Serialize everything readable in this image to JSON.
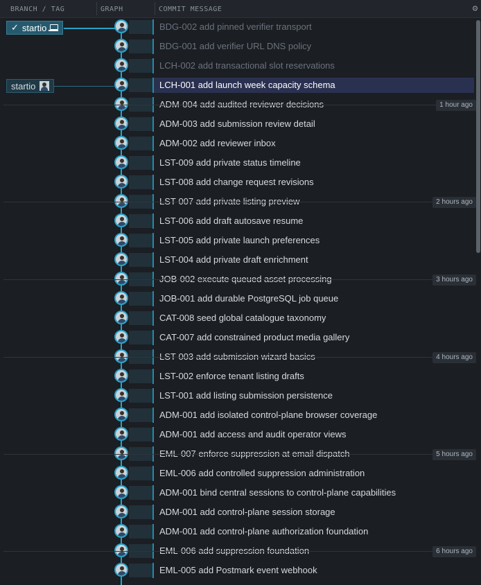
{
  "header": {
    "branch_col": "BRANCH / TAG",
    "graph_col": "GRAPH",
    "message_col": "COMMIT MESSAGE"
  },
  "branches": {
    "local": {
      "label": "startio",
      "check": "✓",
      "icon": "laptop-icon"
    },
    "remote": {
      "label": "startio",
      "icon": "avatar-icon"
    }
  },
  "commits": [
    {
      "message": "BDG-002 add pinned verifier transport",
      "dim": true
    },
    {
      "message": "BDG-001 add verifier URL DNS policy",
      "dim": true
    },
    {
      "message": "LCH-002 add transactional slot reservations",
      "dim": true
    },
    {
      "message": "LCH-001 add launch week capacity schema",
      "selected": true
    },
    {
      "message": "ADM-004 add audited reviewer decisions"
    },
    {
      "message": "ADM-003 add submission review detail"
    },
    {
      "message": "ADM-002 add reviewer inbox"
    },
    {
      "message": "LST-009 add private status timeline"
    },
    {
      "message": "LST-008 add change request revisions"
    },
    {
      "message": "LST-007 add private listing preview"
    },
    {
      "message": "LST-006 add draft autosave resume"
    },
    {
      "message": "LST-005 add private launch preferences"
    },
    {
      "message": "LST-004 add private draft enrichment"
    },
    {
      "message": "JOB-002 execute queued asset processing"
    },
    {
      "message": "JOB-001 add durable PostgreSQL job queue"
    },
    {
      "message": "CAT-008 seed global catalogue taxonomy"
    },
    {
      "message": "CAT-007 add constrained product media gallery"
    },
    {
      "message": "LST-003 add submission wizard basics"
    },
    {
      "message": "LST-002 enforce tenant listing drafts"
    },
    {
      "message": "LST-001 add listing submission persistence"
    },
    {
      "message": "ADM-001 add isolated control-plane browser coverage"
    },
    {
      "message": "ADM-001 add access and audit operator views"
    },
    {
      "message": "EML-007 enforce suppression at email dispatch"
    },
    {
      "message": "EML-006 add controlled suppression administration"
    },
    {
      "message": "ADM-001 bind central sessions to control-plane capabilities"
    },
    {
      "message": "ADM-001 add control-plane session storage"
    },
    {
      "message": "ADM-001 add control-plane authorization foundation"
    },
    {
      "message": "EML-006 add suppression foundation"
    },
    {
      "message": "EML-005 add Postmark event webhook"
    }
  ],
  "time_markers": [
    {
      "label": "1 hour ago",
      "after_row": 4
    },
    {
      "label": "2 hours ago",
      "after_row": 9
    },
    {
      "label": "3 hours ago",
      "after_row": 13
    },
    {
      "label": "4 hours ago",
      "after_row": 17
    },
    {
      "label": "5 hours ago",
      "after_row": 22
    },
    {
      "label": "6 hours ago",
      "after_row": 27
    }
  ],
  "colors": {
    "accent": "#2aa2c8",
    "selected_row": "#2a3150",
    "background": "#1b1e23"
  }
}
